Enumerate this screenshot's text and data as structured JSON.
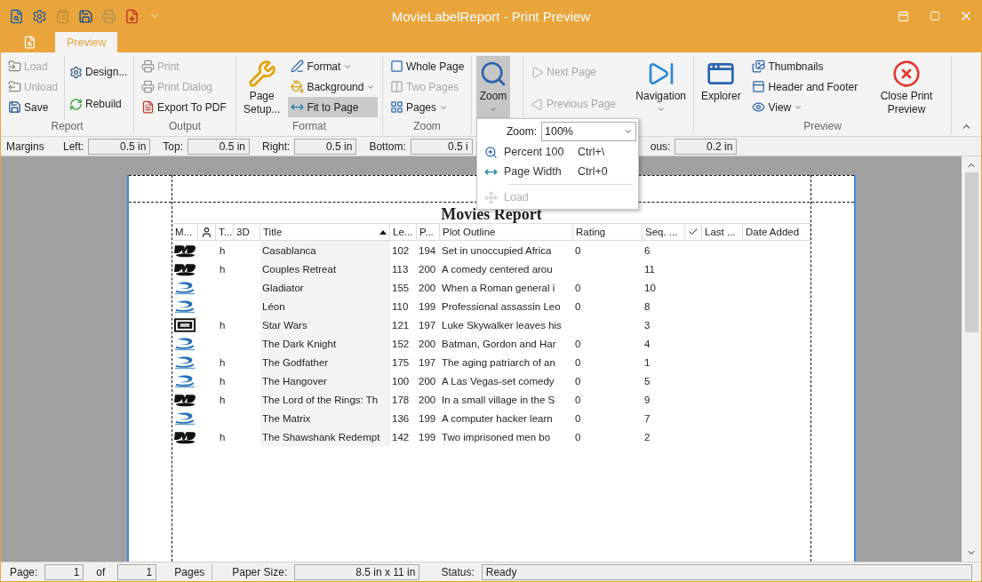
{
  "window": {
    "title": "MovieLabelReport - Print Preview"
  },
  "quick_access": [
    {
      "disabled": false
    },
    {
      "disabled": false
    },
    {
      "disabled": true
    },
    {
      "disabled": false
    },
    {
      "disabled": true
    },
    {
      "disabled": false
    },
    {
      "disabled": false
    }
  ],
  "tabs": [
    {
      "kind": "file",
      "selected": false
    },
    {
      "kind": "text",
      "label": "Preview",
      "selected": true
    }
  ],
  "ribbon": {
    "groups": [
      {
        "label": "Report",
        "columns": [
          {
            "items": [
              {
                "kind": "small",
                "label": "Load",
                "disabled": true
              },
              {
                "kind": "small",
                "label": "Unload",
                "disabled": true
              },
              {
                "kind": "small",
                "label": "Save",
                "disabled": false
              }
            ]
          },
          {
            "items": [
              {
                "kind": "small",
                "label": "Design...",
                "disabled": false
              },
              {
                "kind": "small",
                "label": "Rebuild",
                "disabled": false
              }
            ]
          }
        ]
      },
      {
        "label": "Output",
        "columns": [
          {
            "items": [
              {
                "kind": "small",
                "label": "Print",
                "disabled": true
              },
              {
                "kind": "small",
                "label": "Print Dialog",
                "disabled": true
              },
              {
                "kind": "small",
                "label": "Export To PDF",
                "disabled": false
              }
            ]
          }
        ]
      },
      {
        "label": "Format",
        "columns": [
          {
            "items": [
              {
                "kind": "large",
                "label": "Page Setup...",
                "disabled": false
              }
            ]
          },
          {
            "items": [
              {
                "kind": "small",
                "label": "Format",
                "disabled": false,
                "has_menu": true
              },
              {
                "kind": "small",
                "label": "Background",
                "disabled": false,
                "has_menu": true
              },
              {
                "kind": "small",
                "label": "Fit to Page",
                "disabled": false,
                "selected": true
              }
            ]
          }
        ]
      },
      {
        "label": "Zoom",
        "columns": [
          {
            "items": [
              {
                "kind": "small",
                "label": "Whole Page",
                "disabled": false
              },
              {
                "kind": "small",
                "label": "Two Pages",
                "disabled": true
              },
              {
                "kind": "small",
                "label": "Pages",
                "disabled": false,
                "has_menu": true
              }
            ]
          }
        ]
      },
      {
        "columns": [
          {
            "items": [
              {
                "kind": "large",
                "label": "Zoom",
                "disabled": false,
                "has_menu": true,
                "selected": true
              }
            ]
          }
        ]
      },
      {
        "columns": [
          {
            "items": [
              {
                "kind": "small",
                "label": "Next Page",
                "disabled": true
              },
              {
                "kind": "small",
                "label": "Previous Page",
                "disabled": true
              }
            ]
          },
          {
            "items": [
              {
                "kind": "large",
                "label": "Navigation",
                "disabled": false,
                "has_menu": true
              }
            ]
          }
        ]
      },
      {
        "label": "Preview",
        "columns": [
          {
            "items": [
              {
                "kind": "large",
                "label": "Explorer",
                "disabled": false
              }
            ]
          },
          {
            "items": [
              {
                "kind": "small",
                "label": "Thumbnails",
                "disabled": false
              },
              {
                "kind": "small",
                "label": "Header and Footer",
                "disabled": false
              },
              {
                "kind": "small",
                "label": "View",
                "disabled": false,
                "has_menu": true
              }
            ]
          },
          {
            "items": [
              {
                "kind": "large",
                "label": "Close Print Preview",
                "disabled": false
              }
            ]
          }
        ]
      }
    ]
  },
  "margins_bar": {
    "label": "Margins",
    "fields": [
      {
        "label": "Left:",
        "value": "0.5 in"
      },
      {
        "label": "Top:",
        "value": "0.5 in"
      },
      {
        "label": "Right:",
        "value": "0.5 in"
      },
      {
        "label": "Bottom:",
        "value": "0.5 i"
      },
      {
        "label": "ous:",
        "value": "0.2 in"
      }
    ]
  },
  "zoom_menu": {
    "label": "Zoom:",
    "value": "100%",
    "items": [
      {
        "label": "Percent 100",
        "shortcut": "Ctrl+\\",
        "disabled": false
      },
      {
        "label": "Page Width",
        "shortcut": "Ctrl+0",
        "disabled": false
      },
      {
        "label": "Load",
        "disabled": true
      }
    ]
  },
  "report": {
    "title": "Movies Report",
    "columns": [
      {
        "kind": "text",
        "label": "M..."
      },
      {
        "kind": "person"
      },
      {
        "kind": "text",
        "label": "T..."
      },
      {
        "kind": "text",
        "label": "3D"
      },
      {
        "kind": "text",
        "label": "Title",
        "sorted_ascending": true
      },
      {
        "kind": "text",
        "label": "Le..."
      },
      {
        "kind": "text",
        "label": "P..."
      },
      {
        "kind": "text",
        "label": "Plot Outline"
      },
      {
        "kind": "text",
        "label": "Rating"
      },
      {
        "kind": "text",
        "label": "Seq. ..."
      },
      {
        "kind": "check"
      },
      {
        "kind": "text",
        "label": "Last ..."
      },
      {
        "kind": "text",
        "label": "Date Added"
      }
    ],
    "rows": [
      {
        "kind": "dvd",
        "t": "h",
        "title": "Casablanca",
        "length": "102",
        "year": "194",
        "plot": "Set in unoccupied Africa",
        "rating": "0",
        "seq": "6"
      },
      {
        "kind": "dvd",
        "t": "h",
        "title": "Couples Retreat",
        "length": "113",
        "year": "200",
        "plot": "A comedy centered arou",
        "seq": "11"
      },
      {
        "kind": "bluray",
        "title": "Gladiator",
        "length": "155",
        "year": "200",
        "plot": "When a Roman general i",
        "rating": "0",
        "seq": "10"
      },
      {
        "kind": "bluray",
        "title": "Léon",
        "length": "110",
        "year": "199",
        "plot": "Professional assassin Leo",
        "rating": "0",
        "seq": "8"
      },
      {
        "kind": "vhs",
        "t": "h",
        "title": "Star Wars",
        "length": "121",
        "year": "197",
        "plot": "Luke Skywalker leaves his",
        "seq": "3"
      },
      {
        "kind": "bluray",
        "title": "The Dark Knight",
        "length": "152",
        "year": "200",
        "plot": "Batman, Gordon and Har",
        "rating": "0",
        "seq": "4"
      },
      {
        "kind": "bluray",
        "t": "h",
        "title": "The Godfather",
        "length": "175",
        "year": "197",
        "plot": "The aging patriarch of an",
        "rating": "0",
        "seq": "1"
      },
      {
        "kind": "bluray",
        "t": "h",
        "title": "The Hangover",
        "length": "100",
        "year": "200",
        "plot": "A Las Vegas-set comedy",
        "rating": "0",
        "seq": "5"
      },
      {
        "kind": "dvd",
        "t": "h",
        "title": "The Lord of the Rings: Th",
        "length": "178",
        "year": "200",
        "plot": "In a small village in the S",
        "rating": "0",
        "seq": "9"
      },
      {
        "kind": "bluray",
        "title": "The Matrix",
        "length": "136",
        "year": "199",
        "plot": "A computer hacker learn",
        "rating": "0",
        "seq": "7"
      },
      {
        "kind": "dvd",
        "t": "h",
        "title": "The Shawshank Redempt",
        "length": "142",
        "year": "199",
        "plot": "Two imprisoned men bo",
        "rating": "0",
        "seq": "2"
      }
    ]
  },
  "status_bar": {
    "page_label": "Page:",
    "page": "1",
    "of_label": "of",
    "pages": "1",
    "pages_label": "Pages",
    "paper_label": "Paper Size:",
    "paper": "8.5 in x 11 in",
    "status_label": "Status:",
    "status": "Ready"
  }
}
